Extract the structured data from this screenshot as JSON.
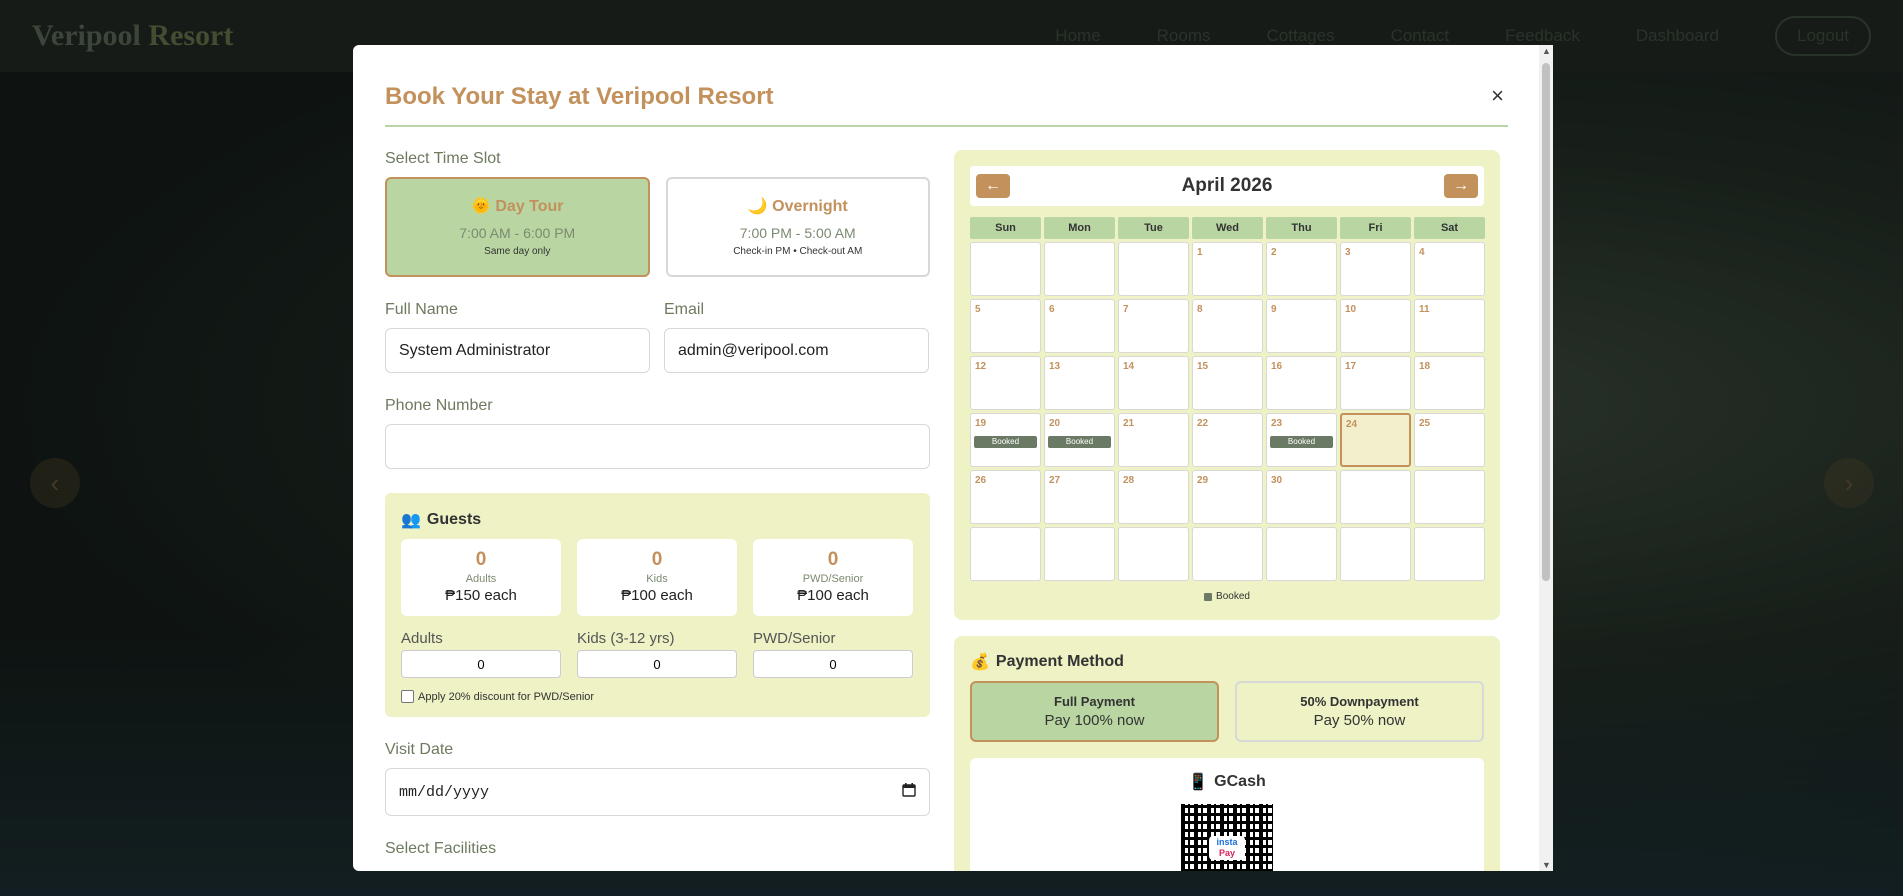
{
  "nav": {
    "brand_main": "Veripool",
    "brand_accent": "Resort",
    "links": [
      "Home",
      "Rooms",
      "Cottages",
      "Contact",
      "Feedback",
      "Dashboard"
    ],
    "logout": "Logout"
  },
  "modal": {
    "title": "Book Your Stay at Veripool Resort",
    "close": "×"
  },
  "time_slot": {
    "label": "Select Time Slot",
    "options": [
      {
        "name": "Day Tour",
        "time": "7:00 AM - 6:00 PM",
        "note": "Same day only",
        "selected": true
      },
      {
        "name": "Overnight",
        "time": "7:00 PM - 5:00 AM",
        "note": "Check-in PM • Check-out AM",
        "selected": false
      }
    ]
  },
  "form": {
    "full_name_label": "Full Name",
    "full_name_value": "System Administrator",
    "email_label": "Email",
    "email_value": "admin@veripool.com",
    "phone_label": "Phone Number",
    "phone_value": ""
  },
  "guests": {
    "title": "Guests",
    "cards": [
      {
        "count": "0",
        "type": "Adults",
        "price": "₱150 each"
      },
      {
        "count": "0",
        "type": "Kids",
        "price": "₱100 each"
      },
      {
        "count": "0",
        "type": "PWD/Senior",
        "price": "₱100 each"
      }
    ],
    "inputs": [
      {
        "label": "Adults",
        "value": "0"
      },
      {
        "label": "Kids (3-12 yrs)",
        "value": "0"
      },
      {
        "label": "PWD/Senior",
        "value": "0"
      }
    ],
    "discount_label": "Apply 20% discount for PWD/Senior"
  },
  "visit": {
    "label": "Visit Date",
    "placeholder": "mm/dd/yyyy"
  },
  "facilities": {
    "label": "Select Facilities"
  },
  "calendar": {
    "month": "April 2026",
    "prev": "←",
    "next": "→",
    "weekdays": [
      "Sun",
      "Mon",
      "Tue",
      "Wed",
      "Thu",
      "Fri",
      "Sat"
    ],
    "leading_blanks": 3,
    "days_in_month": 30,
    "booked_days": [
      19,
      20,
      23
    ],
    "booked_label": "Booked",
    "today": 24,
    "legend": "Booked"
  },
  "payment": {
    "title": "Payment Method",
    "options": [
      {
        "head": "Full Payment",
        "sub": "Pay 100% now",
        "selected": true
      },
      {
        "head": "50% Downpayment",
        "sub": "Pay 50% now",
        "selected": false
      }
    ],
    "gcash_title": "GCash",
    "qr_logo_top": "insta",
    "qr_logo_bottom": "Pay"
  },
  "colors": {
    "accent": "#c2915c",
    "green": "#b9d6a2",
    "panel": "#eef2c5",
    "booked": "#6b7a64"
  }
}
